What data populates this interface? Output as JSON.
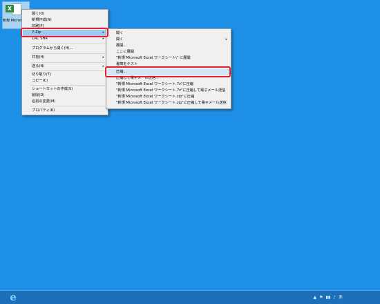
{
  "desktop": {
    "file_icon_label": "新規 Microsoft Excel ワークシート",
    "file_icon_glyph": "X"
  },
  "main_menu": {
    "items": [
      {
        "label": "開く(O)"
      },
      {
        "label": "新規作成(N)"
      },
      {
        "label": "印刷(P)"
      },
      {
        "label": "7-Zip",
        "has_submenu": true
      },
      {
        "label": "CRC SHA",
        "has_submenu": true
      },
      {
        "label": "プログラムから開く(H)..."
      },
      {
        "label": "共有(H)",
        "has_submenu": true
      },
      {
        "label": "送る(N)",
        "has_submenu": true
      },
      {
        "label": "切り取り(T)"
      },
      {
        "label": "コピー(C)"
      },
      {
        "label": "ショートカットの作成(S)"
      },
      {
        "label": "削除(D)"
      },
      {
        "label": "名前の変更(M)"
      },
      {
        "label": "プロパティ(R)"
      }
    ]
  },
  "sub_menu": {
    "items": [
      {
        "label": "開く"
      },
      {
        "label": "開く",
        "has_submenu": true
      },
      {
        "label": "展開..."
      },
      {
        "label": "ここに展開"
      },
      {
        "label": "\"新規 Microsoft Excel ワークシート\\\" に展開"
      },
      {
        "label": "書庫をテスト"
      },
      {
        "label": "圧縮..."
      },
      {
        "label": "圧縮して電子メール送信..."
      },
      {
        "label": "\"新規 Microsoft Excel ワークシート.7z\"に圧縮"
      },
      {
        "label": "\"新規 Microsoft Excel ワークシート.7z\"に圧縮して電子メール送信"
      },
      {
        "label": "\"新規 Microsoft Excel ワークシート.zip\"に圧縮"
      },
      {
        "label": "\"新規 Microsoft Excel ワークシート.zip\"に圧縮して電子メール送信"
      }
    ]
  },
  "arrow_glyph": "▸",
  "taskbar": {
    "ie_glyph": "e",
    "tray_icons": [
      "▲",
      "⚑",
      "▮▮",
      "♪",
      "あ"
    ]
  },
  "colors": {
    "desktop_bg": "#1e8fe6",
    "taskbar_bg": "#1c6fb8",
    "menu_bg": "#f0f0f0",
    "highlight_red": "#e1202b",
    "selected_item": "#9cc8ef"
  }
}
